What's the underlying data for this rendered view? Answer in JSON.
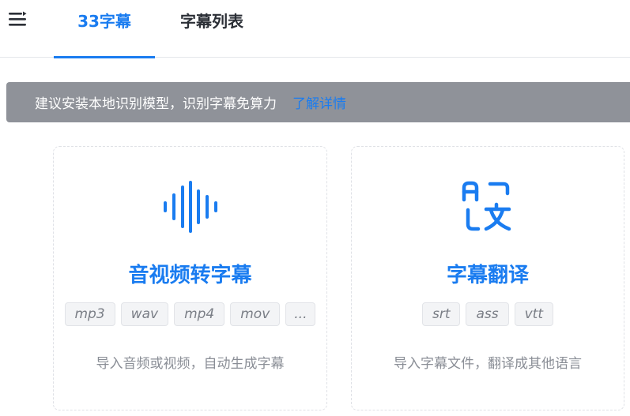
{
  "header": {
    "tabs": [
      {
        "label": "33字幕",
        "active": true
      },
      {
        "label": "字幕列表",
        "active": false
      }
    ]
  },
  "banner": {
    "text": "建议安装本地识别模型，识别字幕免算力",
    "link": "了解详情"
  },
  "cards": [
    {
      "title": "音视频转字幕",
      "icon": "audio-waveform-icon",
      "tags": [
        "mp3",
        "wav",
        "mp4",
        "mov",
        "..."
      ],
      "description": "导入音频或视频，自动生成字幕"
    },
    {
      "title": "字幕翻译",
      "icon": "translate-icon",
      "tags": [
        "srt",
        "ass",
        "vtt"
      ],
      "description": "导入字幕文件，翻译成其他语言"
    }
  ],
  "colors": {
    "accent": "#1a7cf0",
    "banner_bg": "#8f9299",
    "text_dark": "#2b2f36"
  }
}
